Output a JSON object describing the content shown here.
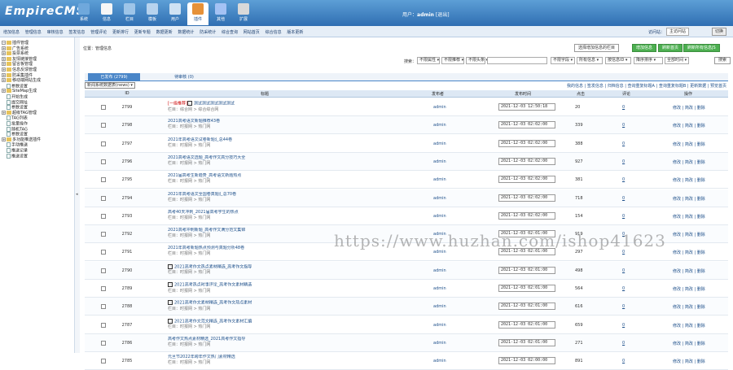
{
  "header": {
    "logo": "EmpireCMS",
    "nav": [
      {
        "label": "系统",
        "color": "#6fa8dc",
        "active": false
      },
      {
        "label": "信息",
        "color": "#f6f6f6",
        "active": false
      },
      {
        "label": "栏目",
        "color": "#9ec5e8",
        "active": false
      },
      {
        "label": "模板",
        "color": "#b7d3ee",
        "active": false
      },
      {
        "label": "用户",
        "color": "#cfe2f3",
        "active": false
      },
      {
        "label": "插件",
        "color": "#e69138",
        "active": true
      },
      {
        "label": "其他",
        "color": "#a4c2f4",
        "active": false
      },
      {
        "label": "扩展",
        "color": "#d9d9d9",
        "active": false
      }
    ],
    "user_label": "用户：",
    "user_name": "admin",
    "logout": "[退出]"
  },
  "subnav": {
    "links": [
      "增加信息",
      "管理信息",
      "审核信息",
      "签发信息",
      "管理评论",
      "更新排行",
      "更新专题",
      "数据更新",
      "数据统计",
      "防采统计",
      "综合查询",
      "网站首页",
      "综合信息",
      "版本更新"
    ],
    "site_label": "访问站：",
    "site_select": "主访问站",
    "switch": "切换"
  },
  "sidebar": {
    "items": [
      {
        "level": 0,
        "kind": "root",
        "label": "插件管理"
      },
      {
        "level": 0,
        "kind": "folder",
        "label": "广告系统"
      },
      {
        "level": 0,
        "kind": "folder",
        "label": "投票系统"
      },
      {
        "level": 0,
        "kind": "folder",
        "label": "友情链接管理"
      },
      {
        "level": 0,
        "kind": "folder",
        "label": "留言板管理"
      },
      {
        "level": 0,
        "kind": "folder",
        "label": "信息反馈管理"
      },
      {
        "level": 0,
        "kind": "folder",
        "label": "防采集插件"
      },
      {
        "level": 0,
        "kind": "folder",
        "label": "移动端网站生成"
      },
      {
        "level": 1,
        "kind": "page",
        "label": "参数设置"
      },
      {
        "level": 0,
        "kind": "folder",
        "label": "SiteMap生成"
      },
      {
        "level": 1,
        "kind": "page",
        "label": "开始生成"
      },
      {
        "level": 1,
        "kind": "page",
        "label": "提交网址"
      },
      {
        "level": 1,
        "kind": "page",
        "label": "参数设置"
      },
      {
        "level": 0,
        "kind": "folder",
        "label": "超级TAG管理"
      },
      {
        "level": 1,
        "kind": "page",
        "label": "TAG列表"
      },
      {
        "level": 1,
        "kind": "page",
        "label": "批量操作"
      },
      {
        "level": 1,
        "kind": "page",
        "label": "随机TAG"
      },
      {
        "level": 1,
        "kind": "page",
        "label": "参数设置"
      },
      {
        "level": 0,
        "kind": "folder",
        "label": "多功能推送插件"
      },
      {
        "level": 1,
        "kind": "page",
        "label": "手动推送"
      },
      {
        "level": 1,
        "kind": "page",
        "label": "推送记录"
      },
      {
        "level": 1,
        "kind": "page",
        "label": "推送设置"
      }
    ]
  },
  "main": {
    "location_label": "位置：",
    "location_value": "管理信息",
    "top_select": "选择增加信息的栏目",
    "btn_add": "增加信息",
    "btn_refresh": "刷新首页",
    "btn_refresh_all": "刷新所有信息JS",
    "search_label": "搜索：",
    "filters": [
      "不限属性",
      "不限推荐",
      "不限头条",
      "不限字段",
      "所有信息",
      "按信息ID",
      "降序排序",
      "全部时间"
    ],
    "search_btn": "搜索",
    "tabs": [
      {
        "label": "已发布 (2799)",
        "active": true
      },
      {
        "label": "待审核 (0)",
        "active": false
      }
    ],
    "table_select": "新闻系统数据表(news)",
    "tool_links": "我的信息 | 签发信息 | 归档信息 | 查询重复标题A | 查询重复标题B | 更新数据 | 预览首页",
    "columns": [
      "ID",
      "标题",
      "发布者",
      "发布时间",
      "点击",
      "评论",
      "操作"
    ],
    "ops": "修改 | 简改 | 删除",
    "rows": [
      {
        "id": "2799",
        "red": "[一级推荐]",
        "icon": true,
        "title": "测试测试测试测试测试",
        "sub": "栏目：综合网 > 综合综合网",
        "publisher": "admin",
        "time": "2021-12-03 12:50:18",
        "clicks": "20",
        "comments": "0"
      },
      {
        "id": "2798",
        "red": "",
        "icon": false,
        "title": "2021高考语文新题推荐43卷",
        "sub": "栏目：时报网 > 热门网",
        "publisher": "admin",
        "time": "2021-12-03 02:02:00",
        "clicks": "339",
        "comments": "0"
      },
      {
        "id": "2797",
        "red": "",
        "icon": false,
        "title": "2021年高考语文试卷新题汇总44卷",
        "sub": "栏目：时报网 > 热门网",
        "publisher": "admin",
        "time": "2021-12-03 02:02:00",
        "clicks": "388",
        "comments": "0"
      },
      {
        "id": "2796",
        "red": "",
        "icon": false,
        "title": "2021高考语文选题_高考作文高分技巧大全",
        "sub": "栏目：时报网 > 热门网",
        "publisher": "admin",
        "time": "2021-12-03 02:02:00",
        "clicks": "927",
        "comments": "0"
      },
      {
        "id": "2795",
        "red": "",
        "icon": false,
        "title": "2021届高考生新趋势_高考语文新题热点",
        "sub": "栏目：时报网 > 热门网",
        "publisher": "admin",
        "time": "2021-12-03 02:02:00",
        "clicks": "381",
        "comments": "0"
      },
      {
        "id": "2794",
        "red": "",
        "icon": false,
        "title": "2021年高考语文全国卷真题汇总70卷",
        "sub": "栏目：时报网 > 热门网",
        "publisher": "admin",
        "time": "2021-12-03 02:02:00",
        "clicks": "718",
        "comments": "0"
      },
      {
        "id": "2793",
        "red": "",
        "icon": false,
        "title": "高考40天冲刺_2021届高考学生的热点",
        "sub": "栏目：时报网 > 热门网",
        "publisher": "admin",
        "time": "2021-12-03 02:02:00",
        "clicks": "154",
        "comments": "0"
      },
      {
        "id": "2792",
        "red": "",
        "icon": false,
        "title": "2021高考冲刺新题_高考作文满分范文集锦",
        "sub": "栏目：时报网 > 热门网",
        "publisher": "admin",
        "time": "2021-12-03 02:01:00",
        "clicks": "919",
        "comments": "0"
      },
      {
        "id": "2791",
        "red": "",
        "icon": false,
        "title": "2021年高考新题热点预测与真题分析48卷",
        "sub": "栏目：时报网 > 热门网",
        "publisher": "admin",
        "time": "2021-12-03 02:01:00",
        "clicks": "297",
        "comments": "0"
      },
      {
        "id": "2790",
        "red": "",
        "icon": true,
        "title": "2021高考作文热点素材精选_高考作文指导",
        "sub": "栏目：时报网 > 热门网",
        "publisher": "admin",
        "time": "2021-12-03 02:01:00",
        "clicks": "498",
        "comments": "0"
      },
      {
        "id": "2789",
        "red": "",
        "icon": true,
        "title": "2021高考热点时事评论_高考作文素材精选",
        "sub": "栏目：时报网 > 热门网",
        "publisher": "admin",
        "time": "2021-12-03 02:01:00",
        "clicks": "564",
        "comments": "0"
      },
      {
        "id": "2788",
        "red": "",
        "icon": true,
        "title": "2021高考作文素材精选_高考作文热点素材",
        "sub": "栏目：时报网 > 热门网",
        "publisher": "admin",
        "time": "2021-12-03 02:01:00",
        "clicks": "616",
        "comments": "0"
      },
      {
        "id": "2787",
        "red": "",
        "icon": true,
        "title": "2021高考作文范文精选_高考作文素材汇编",
        "sub": "栏目：时报网 > 热门网",
        "publisher": "admin",
        "time": "2021-12-03 02:01:00",
        "clicks": "659",
        "comments": "0"
      },
      {
        "id": "2786",
        "red": "",
        "icon": false,
        "title": "高考作文热点素材精选_2021高考作文指导",
        "sub": "栏目：时报网 > 热门网",
        "publisher": "admin",
        "time": "2021-12-03 02:01:00",
        "clicks": "271",
        "comments": "0"
      },
      {
        "id": "2785",
        "red": "",
        "icon": false,
        "title": "元旦节2022年跨年作文热门素材精选",
        "sub": "栏目：时报网 > 热门网",
        "publisher": "admin",
        "time": "2021-12-03 02:00:00",
        "clicks": "891",
        "comments": "0"
      }
    ]
  },
  "watermark": "https://www.huzhan.com/ishop41623"
}
